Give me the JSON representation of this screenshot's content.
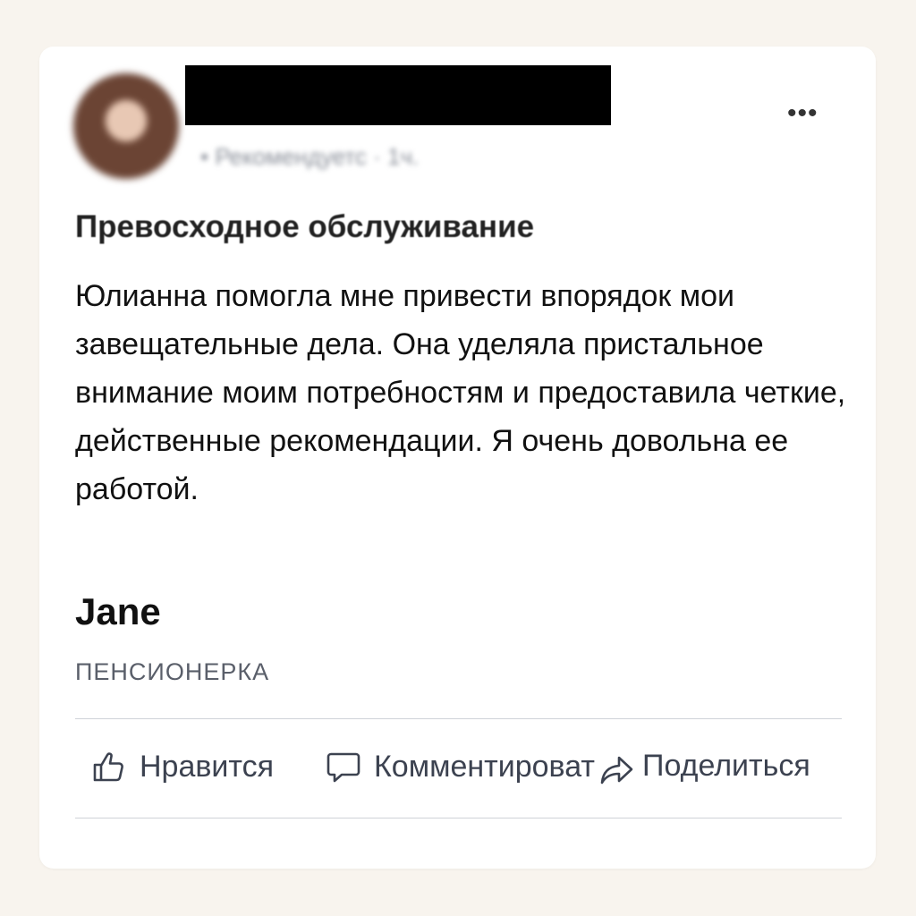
{
  "post": {
    "meta": "• Рекомендуетс · 1ч.",
    "more_label": "•••",
    "title": "Превосходное обслуживание",
    "body": "Юлианна помогла мне привести впорядок мои завещательные дела. Она уделяла пристальное внимание моим потребностям и предоставила четкие, действенные рекомендации. Я очень довольна ее работой.",
    "author": "Jane",
    "role": "ПЕНСИОНЕРКА"
  },
  "actions": {
    "like": {
      "label": "Нравится",
      "icon": "thumbs-up-icon"
    },
    "comment": {
      "label": "Комментироват",
      "icon": "comment-icon"
    },
    "share": {
      "label": "Поделиться",
      "icon": "share-icon"
    }
  },
  "colors": {
    "page_bg": "#f8f4ee",
    "card_bg": "#ffffff",
    "text": "#111111",
    "muted": "#5a5f6a",
    "icon": "#3c4250"
  }
}
